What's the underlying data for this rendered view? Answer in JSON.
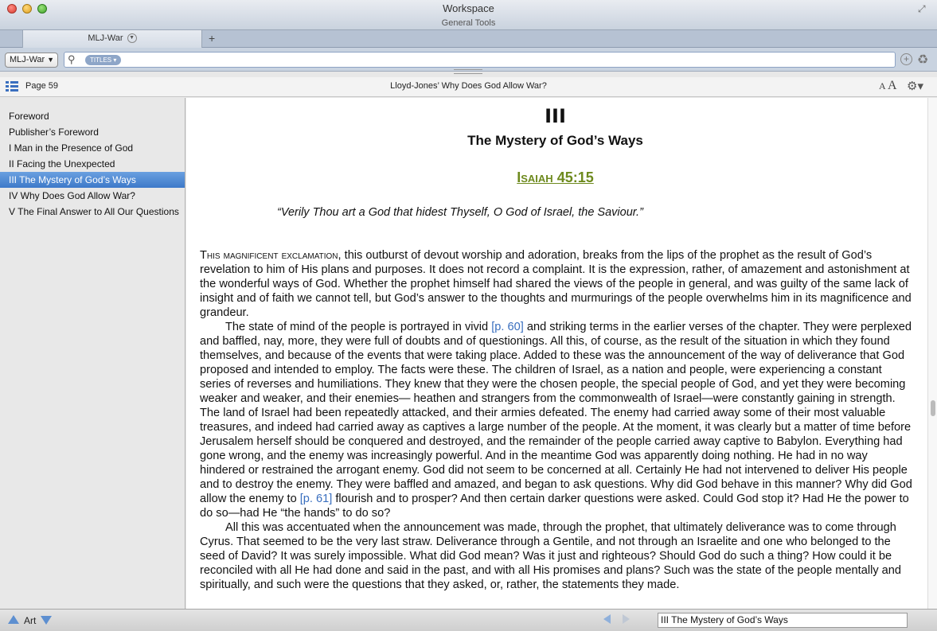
{
  "window": {
    "title": "Workspace",
    "subtitle": "General Tools"
  },
  "tabs": [
    {
      "label": "MLJ-War"
    }
  ],
  "toolbar": {
    "resource_select": "MLJ-War",
    "search_scope": "TITLES",
    "search_value": ""
  },
  "pagebar": {
    "page_label": "Page 59",
    "book_title": "Lloyd-Jones’ Why Does God Allow War?",
    "font_small": "A",
    "font_large": "A"
  },
  "sidebar": {
    "items": [
      {
        "label": "Foreword"
      },
      {
        "label": "Publisher’s Foreword"
      },
      {
        "label": "I Man in the Presence of God"
      },
      {
        "label": "II Facing the Unexpected"
      },
      {
        "label": "III The Mystery of God’s Ways"
      },
      {
        "label": "IV Why Does God Allow War?"
      },
      {
        "label": "V The Final Answer to All Our Questions"
      }
    ],
    "selected_index": 4
  },
  "content": {
    "chapter_number": "III",
    "chapter_title": "The Mystery of God’s Ways",
    "scripture_ref": "Isaiah 45:15",
    "epigraph": "“Verily Thou art a God that hidest Thyself, O God of Israel, the Saviour.”",
    "p1_lead": "This magnificent exclamation",
    "p1_text": ", this outburst of devout worship and adoration, breaks from the lips of the prophet as the result of God’s revelation to him of His plans and purposes. It does not record a complaint. It is the expression, rather, of amazement and astonishment at the wonderful ways of God. Whether the prophet himself had shared the views of the people in general, and was guilty of the same lack of insight and of faith we cannot tell, but God’s answer to the thoughts and murmurings of the people overwhelms him in its magnificence and grandeur.",
    "p2_a": "The state of mind of the people is portrayed in vivid ",
    "p2_link1": "[p. 60]",
    "p2_b": " and striking terms in the earlier verses of the chapter. They were perplexed and baffled, nay, more, they were full of doubts and of questionings. All this, of course, as the result of the situation in which they found themselves, and because of the events that were taking place. Added to these was the announcement of the way of deliverance that God proposed and intended to employ. The facts were these. The children of Israel, as a nation and people, were experiencing a constant series of reverses and humiliations. They knew that they were the chosen people, the special people of God, and yet they were becoming weaker and weaker, and their enemies— heathen and strangers from the commonwealth of Israel—were constantly gaining in strength. The land of Israel had been repeatedly attacked, and their armies defeated. The enemy had carried away some of their most valuable treasures, and indeed had carried away as captives a large number of the people. At the moment, it was clearly but a matter of time before Jerusalem herself should be conquered and destroyed, and the remainder of the people carried away captive to Babylon. Everything had gone wrong, and the enemy was increasingly powerful. And in the meantime God was apparently doing nothing. He had in no way hindered or restrained the arrogant enemy. God did not seem to be concerned at all. Certainly He had not intervened to deliver His people and to destroy the enemy. They were baffled and amazed, and began to ask questions. Why did God behave in this manner? Why did God allow the enemy to ",
    "p2_link2": "[p. 61]",
    "p2_c": " flourish and to prosper? And then certain darker questions were asked. Could God stop it? Had He the power to do so—had He “the hands” to do so?",
    "p3": "All this was accentuated when the announcement was made, through the prophet, that ultimately deliverance was to come through Cyrus. That seemed to be the very last straw. Deliverance through a Gentile, and not through an Israelite and one who belonged to the seed of David? It was surely impossible. What did God mean? Was it just and righteous? Should God do such a thing? How could it be reconciled with all He had done and said in the past, and with all His promises and plans? Such was the state of the people mentally and spiritually, and such were the questions that they asked, or, rather, the statements they made."
  },
  "statusbar": {
    "label": "Art",
    "location": "III The Mystery of God’s Ways"
  },
  "colors": {
    "accent": "#3d79c9",
    "scripture_link": "#6e8a1e",
    "page_link": "#3a6fbf"
  }
}
